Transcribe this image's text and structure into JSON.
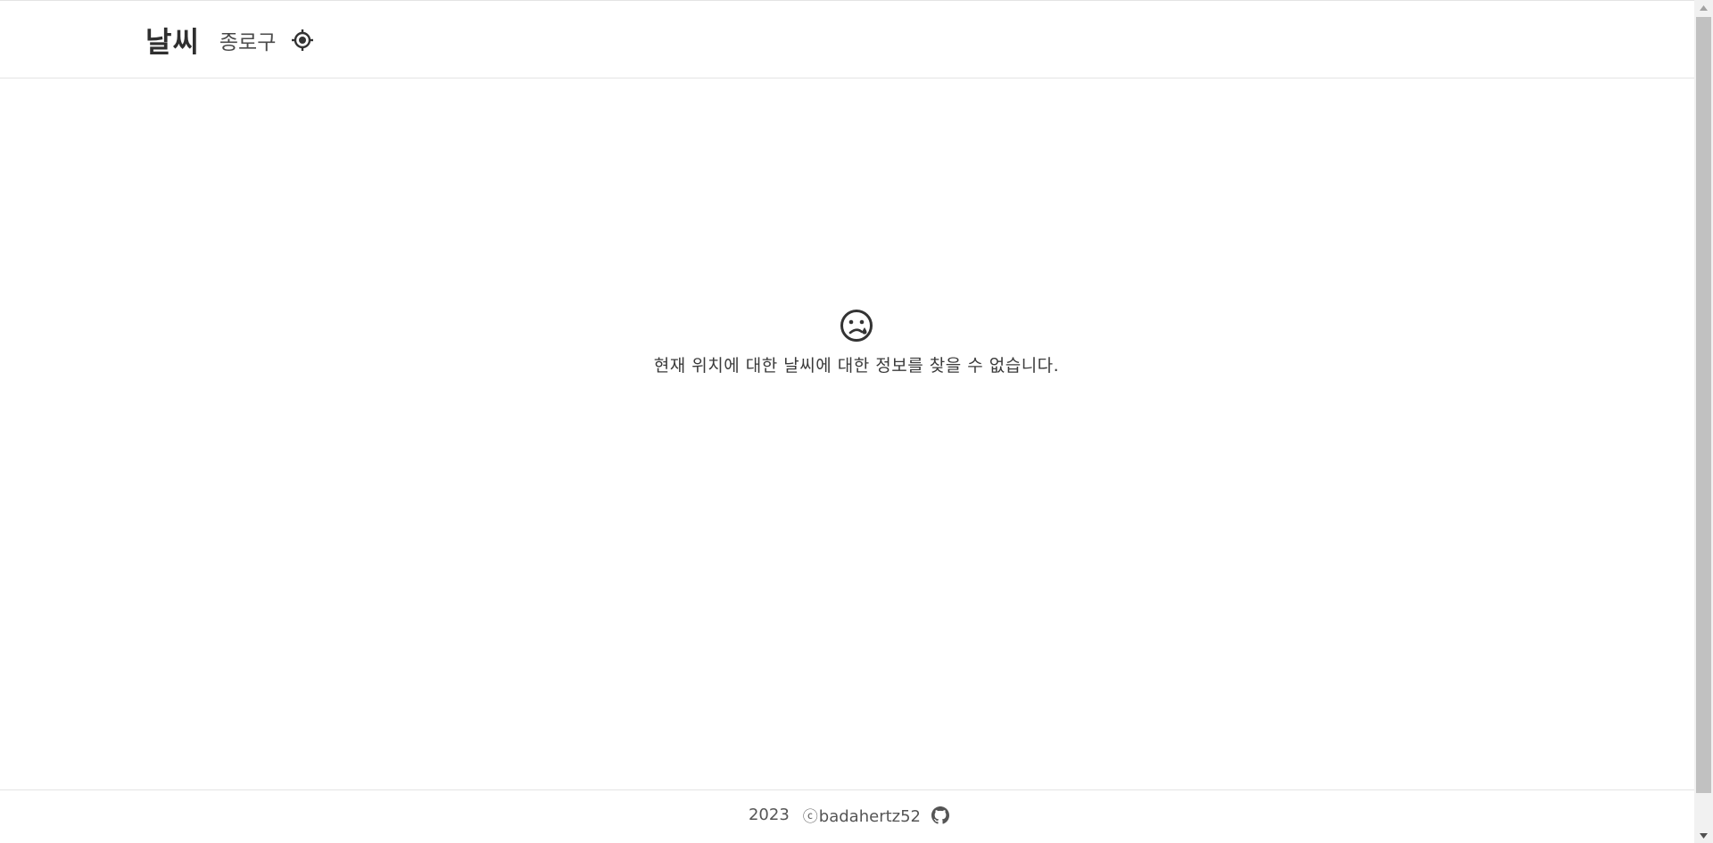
{
  "header": {
    "brand": "날씨",
    "location": "종로구",
    "locate_icon": "crosshair-location-icon"
  },
  "main": {
    "error_icon": "sad-face-icon",
    "error_message": "현재 위치에 대한 날씨에 대한 정보를 찾을 수 없습니다."
  },
  "footer": {
    "year": "2023",
    "copyright_symbol": "ⓒ",
    "author": "badahertz52",
    "github_icon": "github-icon"
  },
  "colors": {
    "text": "#3a3a3a",
    "border": "#e4e4e4",
    "scroll_thumb": "#c1c1c1"
  }
}
